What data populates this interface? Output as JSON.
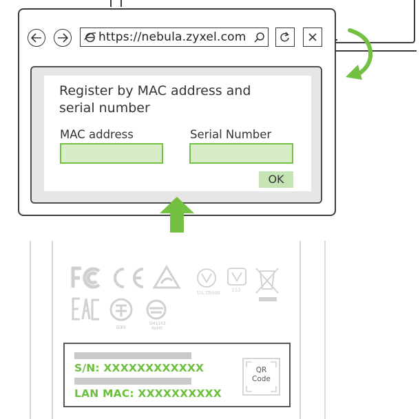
{
  "browser": {
    "url": "https://nebula.zyxel.com",
    "icons": [
      "back-arrow-icon",
      "forward-arrow-icon",
      "internet-explorer-icon",
      "search-icon",
      "refresh-icon",
      "close-icon"
    ]
  },
  "form": {
    "title": "Register by MAC address and serial number",
    "mac_label": "MAC address",
    "serial_label": "Serial Number",
    "ok_label": "OK"
  },
  "device_label": {
    "marks": {
      "ua_code": "UA.TR008",
      "ua_code2": "153",
      "ctick_num": "030",
      "rohs_code": "D41163",
      "rohs_text": "RoHS"
    },
    "serial": "S/N: XXXXXXXXXXXX",
    "mac": "LAN MAC: XXXXXXXXXX",
    "qr_line1": "QR",
    "qr_line2": "Code"
  },
  "colors": {
    "accent_green": "#74c043",
    "field_fill": "#d6edc8",
    "text_green": "#6abf3b",
    "cert_grey": "#d0d0d0"
  }
}
